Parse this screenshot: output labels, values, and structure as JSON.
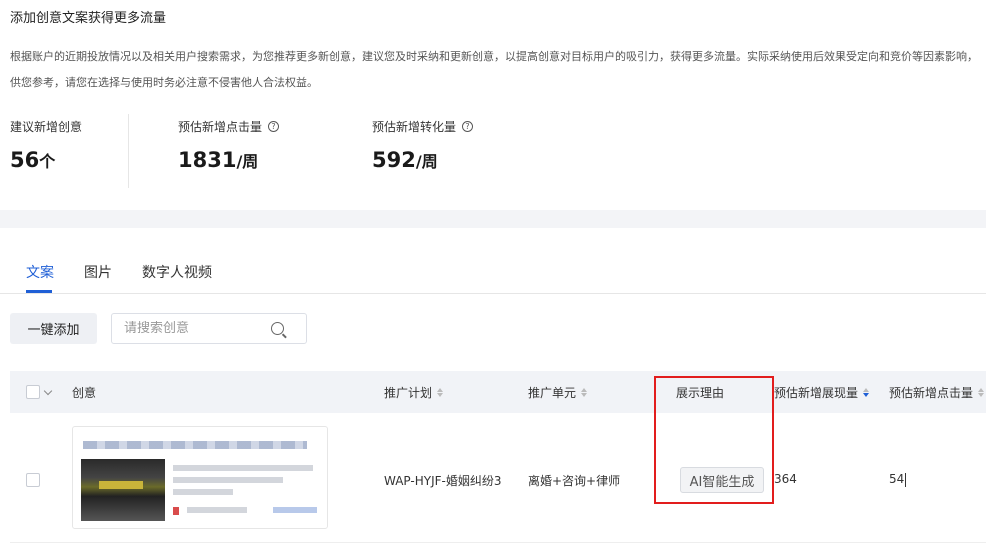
{
  "page_title": "添加创意文案获得更多流量",
  "description": {
    "line1": "根据账户的近期投放情况以及相关用户搜索需求，为您推荐更多新创意，建议您及时采纳和更新创意，以提高创意对目标用户的吸引力，获得更多流量。实际采纳使用后效果受定向和竞价等因素影响，",
    "line2": "供您参考，请您在选择与使用时务必注意不侵害他人合法权益。"
  },
  "stats": [
    {
      "label": "建议新增创意",
      "value": "56",
      "unit": "个",
      "has_help": false
    },
    {
      "label": "预估新增点击量",
      "value": "1831",
      "unit": "/周",
      "has_help": true
    },
    {
      "label": "预估新增转化量",
      "value": "592",
      "unit": "/周",
      "has_help": true
    }
  ],
  "tabs": [
    {
      "label": "文案",
      "active": true
    },
    {
      "label": "图片",
      "active": false
    },
    {
      "label": "数字人视频",
      "active": false
    }
  ],
  "toolbar": {
    "add_all_label": "一键添加",
    "search_placeholder": "请搜索创意"
  },
  "table": {
    "columns": [
      {
        "label": "创意",
        "sortable": false
      },
      {
        "label": "推广计划",
        "sortable": true
      },
      {
        "label": "推广单元",
        "sortable": true
      },
      {
        "label": "展示理由",
        "sortable": false
      },
      {
        "label": "预估新增展现量",
        "sortable": true,
        "sort_active": true
      },
      {
        "label": "预估新增点击量",
        "sortable": true
      }
    ],
    "rows": [
      {
        "plan": "WAP-HYJF-婚姻纠纷3",
        "unit": "离婚+咨询+律师",
        "reason": "AI智能生成",
        "impressions": "364",
        "clicks": "54"
      }
    ]
  },
  "colors": {
    "accent": "#1f5fd6",
    "highlight": "#e21d1d",
    "header_bg": "#f1f3f7"
  }
}
